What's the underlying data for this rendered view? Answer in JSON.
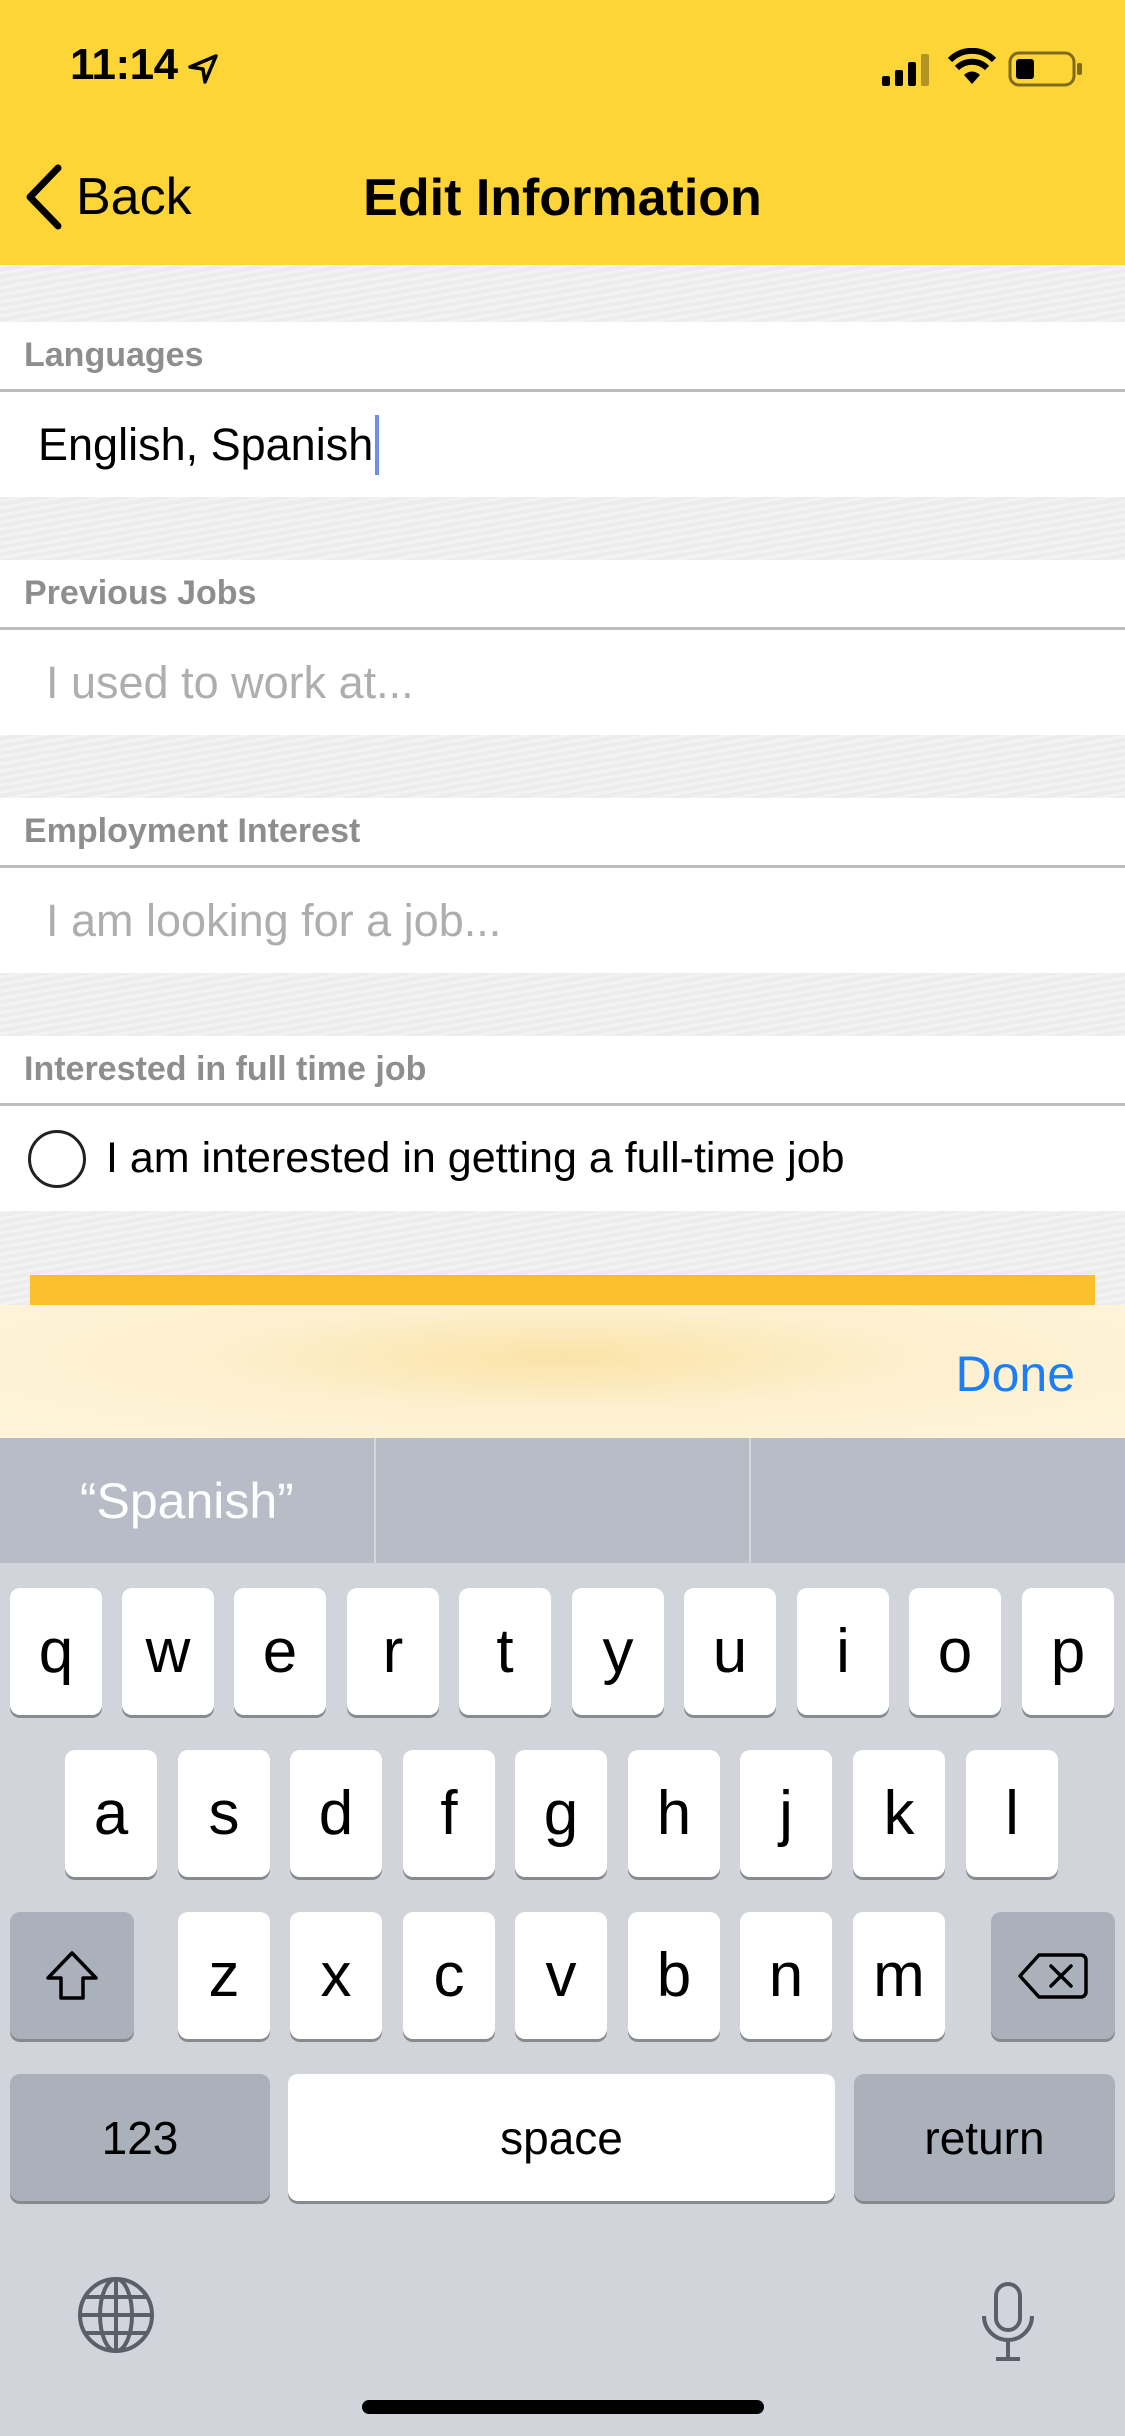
{
  "status_bar": {
    "time": "11:14"
  },
  "nav": {
    "back_label": "Back",
    "title": "Edit Information"
  },
  "form": {
    "languages": {
      "label": "Languages",
      "value": "English, Spanish"
    },
    "previous_jobs": {
      "label": "Previous Jobs",
      "placeholder": "I used to work at..."
    },
    "employment_interest": {
      "label": "Employment Interest",
      "placeholder": "I am looking for a job..."
    },
    "full_time": {
      "label": "Interested in full time job",
      "option_label": "I am interested in getting a full-time job"
    }
  },
  "accessory": {
    "done_label": "Done"
  },
  "keyboard": {
    "suggestions": [
      "“Spanish”",
      "",
      ""
    ],
    "row1": [
      "q",
      "w",
      "e",
      "r",
      "t",
      "y",
      "u",
      "i",
      "o",
      "p"
    ],
    "row2": [
      "a",
      "s",
      "d",
      "f",
      "g",
      "h",
      "j",
      "k",
      "l"
    ],
    "row3": [
      "z",
      "x",
      "c",
      "v",
      "b",
      "n",
      "m"
    ],
    "numbers_label": "123",
    "space_label": "space",
    "return_label": "return"
  },
  "colors": {
    "topbar": "#fdd537",
    "accent_blue": "#1c7ef6",
    "submit_button": "#fdbf2d"
  }
}
